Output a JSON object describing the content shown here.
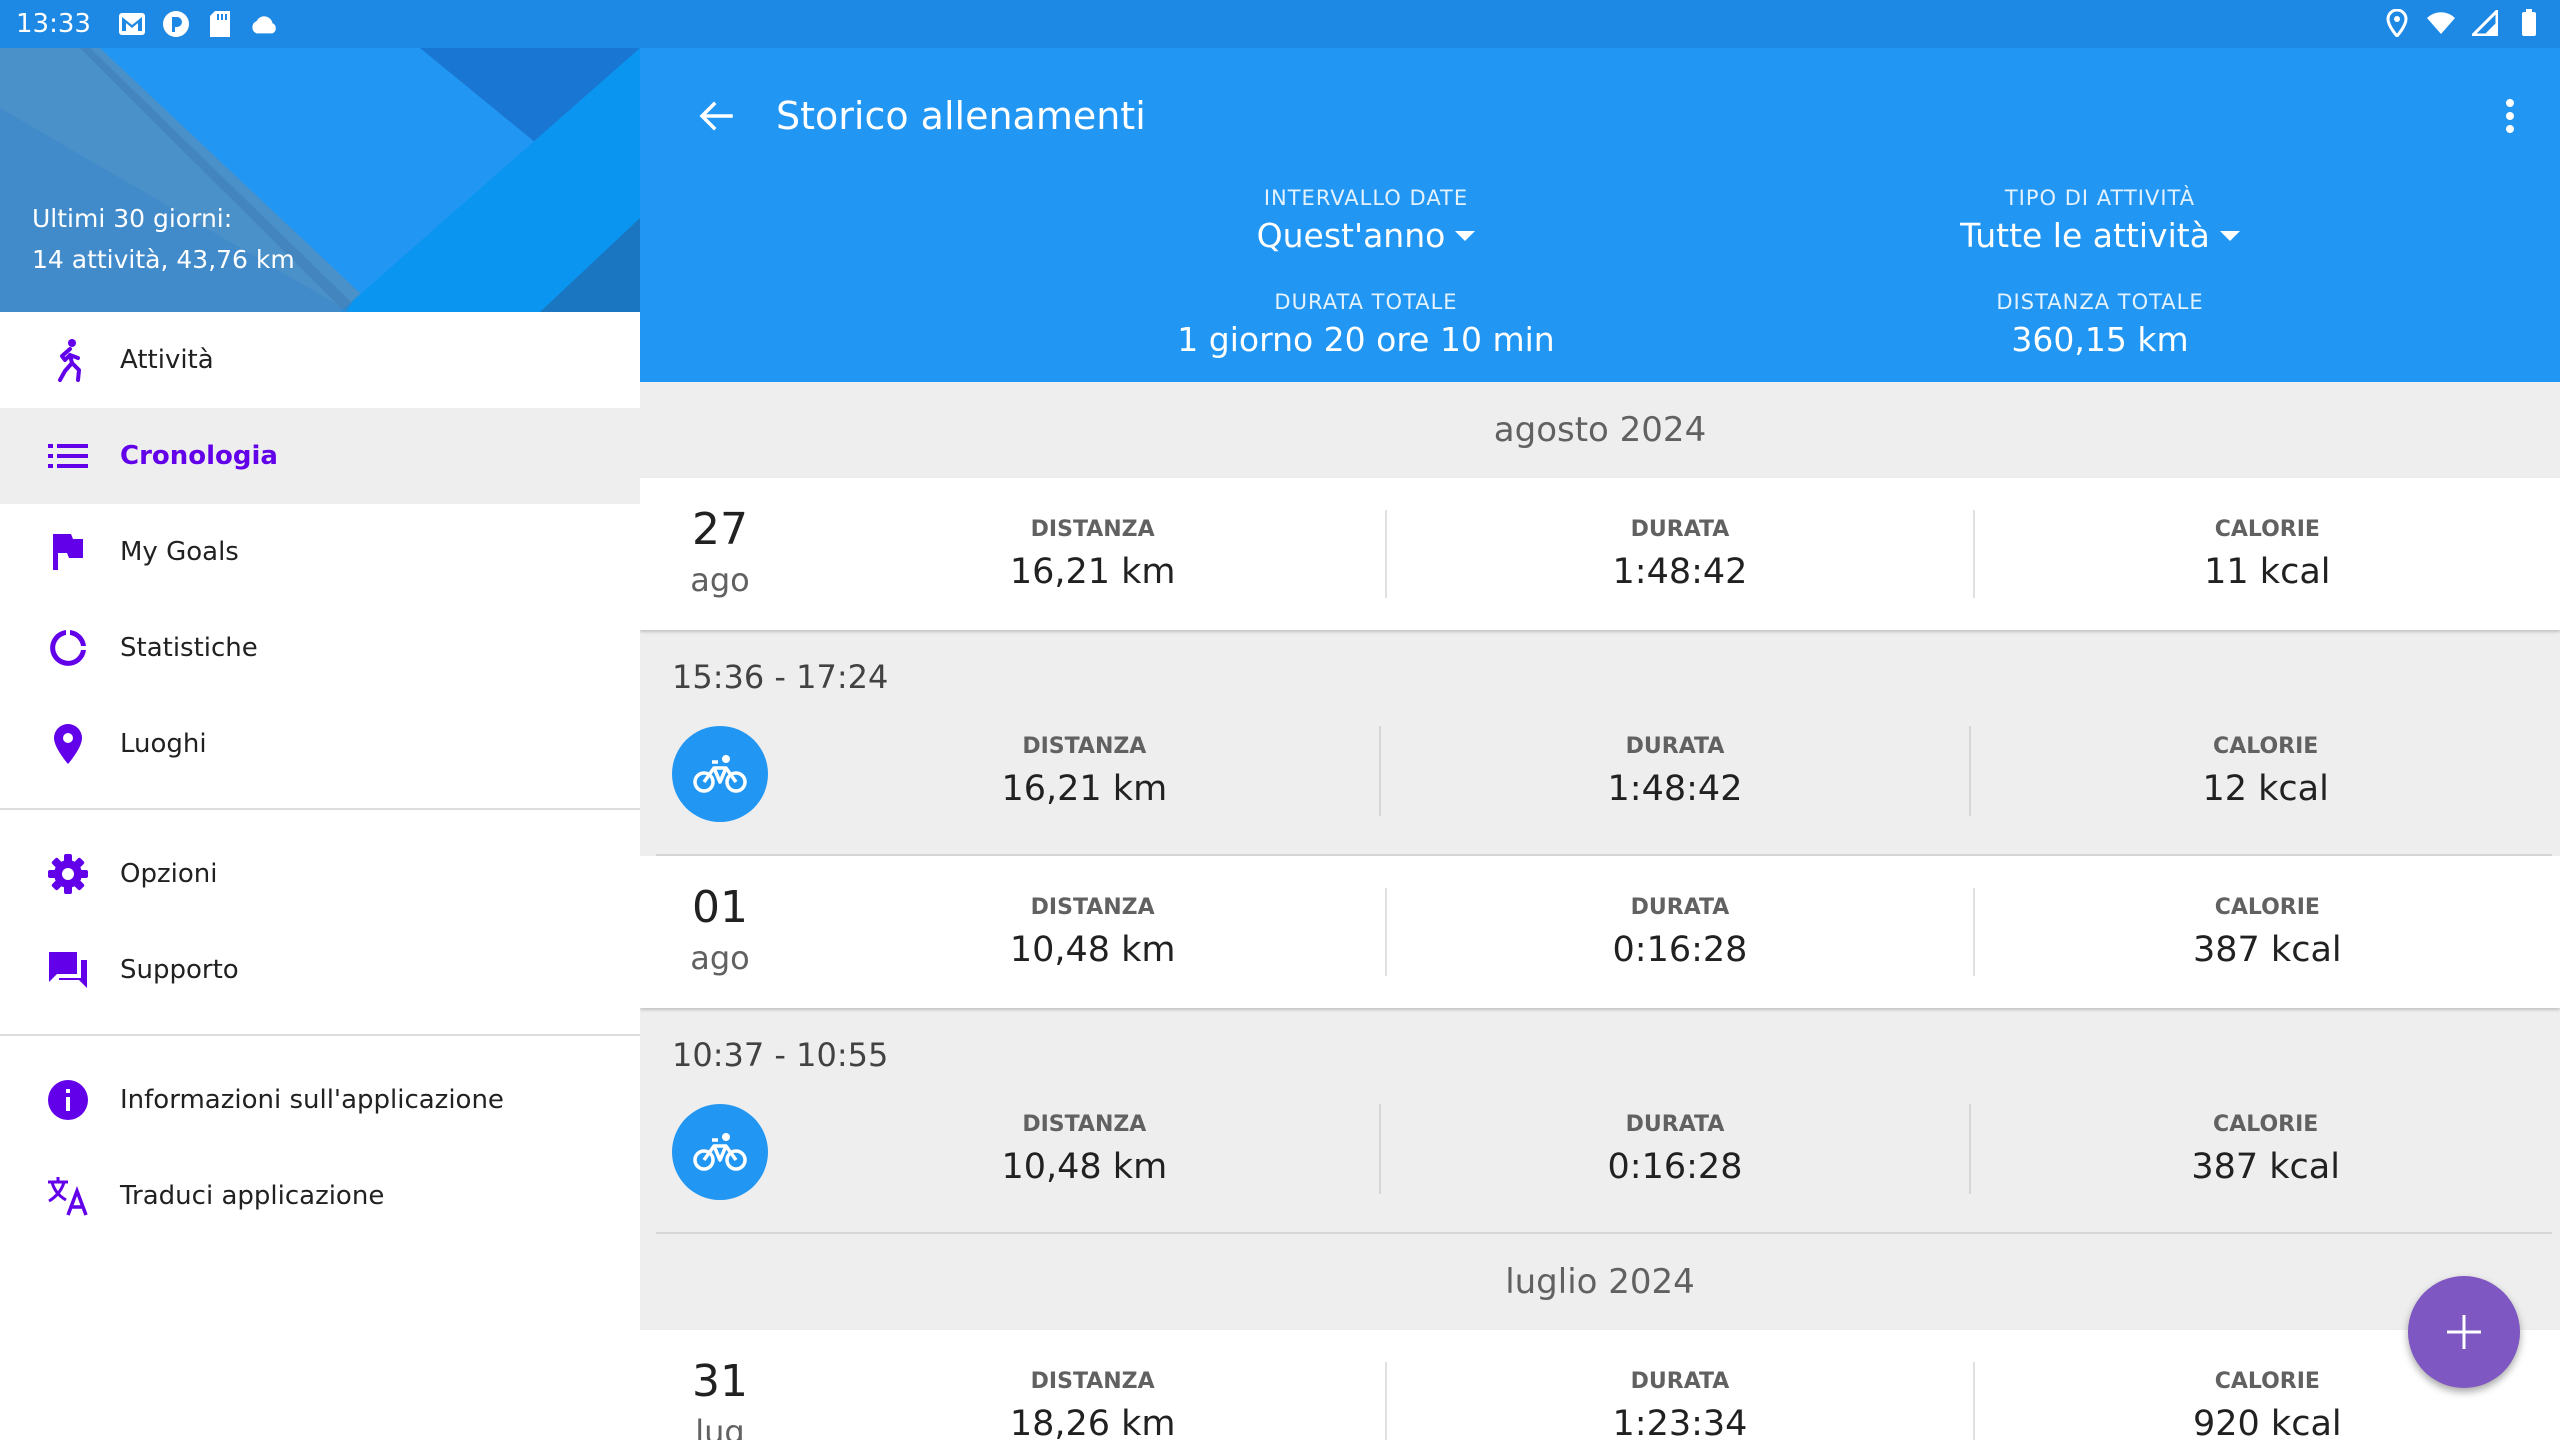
{
  "status_bar": {
    "time": "13:33",
    "left_icons": [
      "gmail-icon",
      "app-icon",
      "sd-card-icon",
      "cloud-icon"
    ],
    "right_icons": [
      "location-icon",
      "wifi-icon",
      "signal-icon",
      "battery-icon"
    ]
  },
  "drawer": {
    "summary_line1": "Ultimi 30 giorni:",
    "summary_line2": "14 attività, 43,76 km",
    "groups": [
      [
        {
          "label": "Attività",
          "icon": "run-icon",
          "active": false
        },
        {
          "label": "Cronologia",
          "icon": "list-icon",
          "active": true
        },
        {
          "label": "My Goals",
          "icon": "flag-icon",
          "active": false
        },
        {
          "label": "Statistiche",
          "icon": "donut-chart-icon",
          "active": false
        },
        {
          "label": "Luoghi",
          "icon": "location-pin-icon",
          "active": false
        }
      ],
      [
        {
          "label": "Opzioni",
          "icon": "gear-icon",
          "active": false
        },
        {
          "label": "Supporto",
          "icon": "chat-icon",
          "active": false
        }
      ],
      [
        {
          "label": "Informazioni sull'applicazione",
          "icon": "info-icon",
          "active": false
        },
        {
          "label": "Traduci applicazione",
          "icon": "translate-icon",
          "active": false
        }
      ]
    ]
  },
  "appbar": {
    "title": "Storico allenamenti",
    "date_range_label": "INTERVALLO DATE",
    "date_range_value": "Quest'anno",
    "activity_type_label": "TIPO DI ATTIVITÀ",
    "activity_type_value": "Tutte le attività",
    "total_duration_label": "DURATA TOTALE",
    "total_duration_value": "1 giorno 20 ore 10 min",
    "total_distance_label": "DISTANZA TOTALE",
    "total_distance_value": "360,15 km"
  },
  "labels": {
    "distance": "DISTANZA",
    "duration": "DURATA",
    "calories": "CALORIE"
  },
  "list": {
    "months": [
      {
        "name": "agosto 2024",
        "days": [
          {
            "day": "27",
            "month": "ago",
            "distance": "16,21 km",
            "duration": "1:48:42",
            "calories": "11 kcal",
            "activities": [
              {
                "time": "15:36 - 17:24",
                "icon": "bike-icon",
                "distance": "16,21 km",
                "duration": "1:48:42",
                "calories": "12 kcal"
              }
            ]
          },
          {
            "day": "01",
            "month": "ago",
            "distance": "10,48 km",
            "duration": "0:16:28",
            "calories": "387 kcal",
            "activities": [
              {
                "time": "10:37 - 10:55",
                "icon": "bike-icon",
                "distance": "10,48 km",
                "duration": "0:16:28",
                "calories": "387 kcal"
              }
            ]
          }
        ]
      },
      {
        "name": "luglio 2024",
        "days": [
          {
            "day": "31",
            "month": "lug",
            "distance": "18,26 km",
            "duration": "1:23:34",
            "calories": "920 kcal",
            "activities": []
          }
        ]
      }
    ]
  },
  "colors": {
    "primary": "#2196f3",
    "status_bar": "#1e88e5",
    "accent": "#6200ea",
    "fab": "#7e57c2"
  }
}
